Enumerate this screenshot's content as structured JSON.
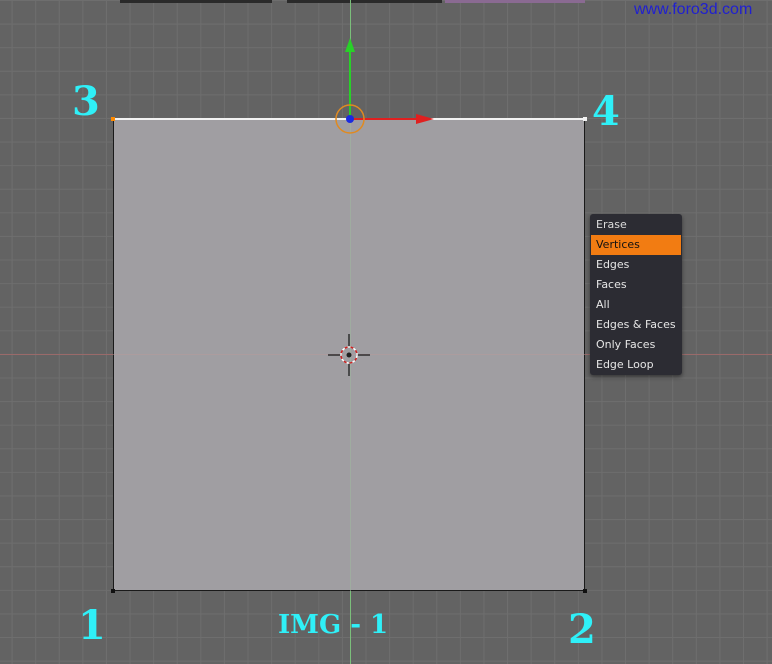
{
  "watermark": "www.foro3d.com",
  "caption": "IMG - 1",
  "corner_labels": {
    "bottom_left": "1",
    "bottom_right": "2",
    "top_left": "3",
    "top_right": "4"
  },
  "menu": {
    "title": "Erase",
    "items": [
      {
        "label": "Vertices",
        "active": true
      },
      {
        "label": "Edges",
        "active": false
      },
      {
        "label": "Faces",
        "active": false
      },
      {
        "label": "All",
        "active": false
      },
      {
        "label": "Edges & Faces",
        "active": false
      },
      {
        "label": "Only Faces",
        "active": false
      },
      {
        "label": "Edge Loop",
        "active": false
      }
    ]
  },
  "colors": {
    "viewport_bg": "#636363",
    "face": "#a09ea2",
    "label_cyan": "#2ff0f8",
    "menu_bg": "#2c2c33",
    "menu_highlight": "#f27c12",
    "axis_x": "#e03030",
    "axis_y": "#30c030"
  },
  "icons": [
    "transform-gizmo-icon",
    "3d-cursor-icon"
  ]
}
